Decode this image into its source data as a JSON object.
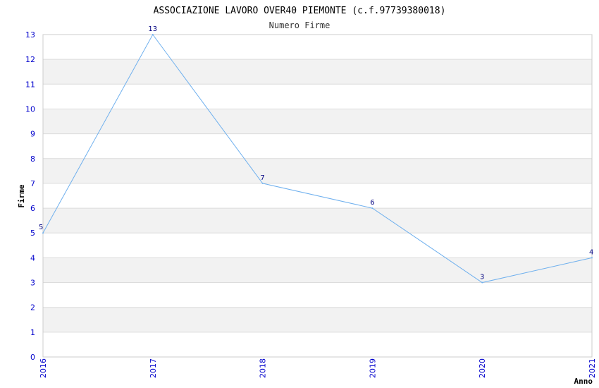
{
  "chart_data": {
    "type": "line",
    "title": "ASSOCIAZIONE LAVORO OVER40 PIEMONTE (c.f.97739380018)",
    "subtitle": "Numero Firme",
    "xlabel": "Anno",
    "ylabel": "Firme",
    "x": [
      "2016",
      "2017",
      "2018",
      "2019",
      "2020",
      "2021"
    ],
    "values": [
      5,
      13,
      7,
      6,
      3,
      4
    ],
    "ylim": [
      0,
      13
    ],
    "yticks": [
      "0",
      "1",
      "2",
      "3",
      "4",
      "5",
      "6",
      "7",
      "8",
      "9",
      "10",
      "11",
      "12",
      "13"
    ],
    "grid": true,
    "colors": {
      "line": "#6fb0ee",
      "tick_text": "#0000cc",
      "data_label": "#000080",
      "band": "#f2f2f2",
      "grid": "#dcdcdc"
    }
  }
}
